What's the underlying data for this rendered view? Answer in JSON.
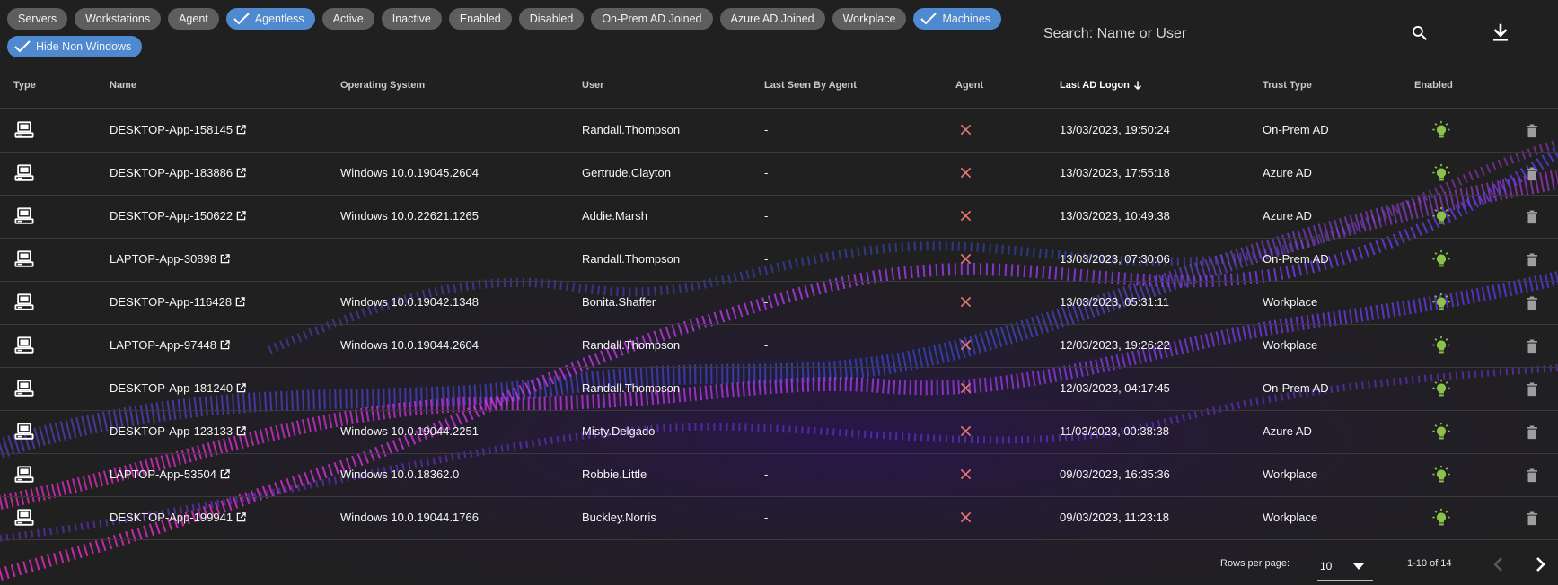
{
  "colors": {
    "chip_default": "#5e5e5e",
    "chip_selected": "#4f8ad1",
    "agent_no": "#e57373",
    "enabled_yes": "#8bc34a",
    "background": "#202020"
  },
  "filters": [
    {
      "label": "Servers",
      "selected": false
    },
    {
      "label": "Workstations",
      "selected": false
    },
    {
      "label": "Agent",
      "selected": false
    },
    {
      "label": "Agentless",
      "selected": true
    },
    {
      "label": "Active",
      "selected": false
    },
    {
      "label": "Inactive",
      "selected": false
    },
    {
      "label": "Enabled",
      "selected": false
    },
    {
      "label": "Disabled",
      "selected": false
    },
    {
      "label": "On-Prem AD Joined",
      "selected": false
    },
    {
      "label": "Azure AD Joined",
      "selected": false
    },
    {
      "label": "Workplace",
      "selected": false
    },
    {
      "label": "Machines",
      "selected": true
    },
    {
      "label": "Hide Non Windows",
      "selected": true
    }
  ],
  "search": {
    "placeholder": "Search: Name or User",
    "value": ""
  },
  "table": {
    "headers": {
      "type": "Type",
      "name": "Name",
      "os": "Operating System",
      "user": "User",
      "last_seen": "Last Seen By Agent",
      "agent": "Agent",
      "last_logon": "Last AD Logon",
      "trust": "Trust Type",
      "enabled": "Enabled"
    },
    "sort": {
      "column": "last_logon",
      "direction": "desc"
    },
    "rows": [
      {
        "type": "computer-icon",
        "name": "DESKTOP-App-158145",
        "os": "",
        "user": "Randall.Thompson",
        "last_seen": "-",
        "agent": false,
        "last_logon": "13/03/2023, 19:50:24",
        "trust": "On-Prem AD",
        "enabled": true
      },
      {
        "type": "computer-icon",
        "name": "DESKTOP-App-183886",
        "os": "Windows 10.0.19045.2604",
        "user": "Gertrude.Clayton",
        "last_seen": "-",
        "agent": false,
        "last_logon": "13/03/2023, 17:55:18",
        "trust": "Azure AD",
        "enabled": true
      },
      {
        "type": "computer-icon",
        "name": "DESKTOP-App-150622",
        "os": "Windows 10.0.22621.1265",
        "user": "Addie.Marsh",
        "last_seen": "-",
        "agent": false,
        "last_logon": "13/03/2023, 10:49:38",
        "trust": "Azure AD",
        "enabled": true
      },
      {
        "type": "computer-icon",
        "name": "LAPTOP-App-30898",
        "os": "",
        "user": "Randall.Thompson",
        "last_seen": "-",
        "agent": false,
        "last_logon": "13/03/2023, 07:30:06",
        "trust": "On-Prem AD",
        "enabled": true
      },
      {
        "type": "computer-icon",
        "name": "DESKTOP-App-116428",
        "os": "Windows 10.0.19042.1348",
        "user": "Bonita.Shaffer",
        "last_seen": "-",
        "agent": false,
        "last_logon": "13/03/2023, 05:31:11",
        "trust": "Workplace",
        "enabled": true
      },
      {
        "type": "computer-icon",
        "name": "LAPTOP-App-97448",
        "os": "Windows 10.0.19044.2604",
        "user": "Randall.Thompson",
        "last_seen": "-",
        "agent": false,
        "last_logon": "12/03/2023, 19:26:22",
        "trust": "Workplace",
        "enabled": true
      },
      {
        "type": "computer-icon",
        "name": "DESKTOP-App-181240",
        "os": "",
        "user": "Randall.Thompson",
        "last_seen": "-",
        "agent": false,
        "last_logon": "12/03/2023, 04:17:45",
        "trust": "On-Prem AD",
        "enabled": true
      },
      {
        "type": "computer-icon",
        "name": "DESKTOP-App-123133",
        "os": "Windows 10.0.19044.2251",
        "user": "Misty.Delgado",
        "last_seen": "-",
        "agent": false,
        "last_logon": "11/03/2023, 00:38:38",
        "trust": "Azure AD",
        "enabled": true
      },
      {
        "type": "computer-icon",
        "name": "LAPTOP-App-53504",
        "os": "Windows 10.0.18362.0",
        "user": "Robbie.Little",
        "last_seen": "-",
        "agent": false,
        "last_logon": "09/03/2023, 16:35:36",
        "trust": "Workplace",
        "enabled": true
      },
      {
        "type": "computer-icon",
        "name": "DESKTOP-App-199941",
        "os": "Windows 10.0.19044.1766",
        "user": "Buckley.Norris",
        "last_seen": "-",
        "agent": false,
        "last_logon": "09/03/2023, 11:23:18",
        "trust": "Workplace",
        "enabled": true
      }
    ]
  },
  "pagination": {
    "rows_per_page_label": "Rows per page:",
    "rows_per_page": "10",
    "page_info": "1-10 of 14"
  }
}
